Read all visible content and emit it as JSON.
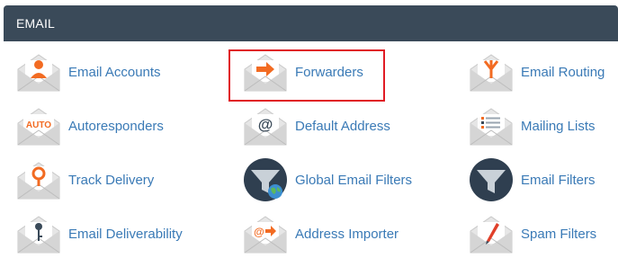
{
  "header": {
    "title": "EMAIL"
  },
  "items": [
    {
      "label": "Email Accounts",
      "icon": "user-envelope-icon"
    },
    {
      "label": "Forwarders",
      "icon": "arrow-envelope-icon"
    },
    {
      "label": "Email Routing",
      "icon": "routing-envelope-icon"
    },
    {
      "label": "Autoresponders",
      "icon": "auto-envelope-icon"
    },
    {
      "label": "Default Address",
      "icon": "at-envelope-icon"
    },
    {
      "label": "Mailing Lists",
      "icon": "list-envelope-icon"
    },
    {
      "label": "Track Delivery",
      "icon": "location-pin-envelope-icon"
    },
    {
      "label": "Global Email Filters",
      "icon": "globe-funnel-icon"
    },
    {
      "label": "Email Filters",
      "icon": "funnel-icon"
    },
    {
      "label": "Email Deliverability",
      "icon": "key-envelope-icon"
    },
    {
      "label": "Address Importer",
      "icon": "import-envelope-icon"
    },
    {
      "label": "Spam Filters",
      "icon": "pen-envelope-icon"
    }
  ],
  "icon_text": {
    "auto": "AUTO",
    "at": "@"
  },
  "colors": {
    "header_bg": "#3a4a59",
    "link": "#3a7ab6",
    "accent": "#f26b22",
    "highlight": "#e01b24",
    "funnel_bg": "#2f3f50"
  }
}
